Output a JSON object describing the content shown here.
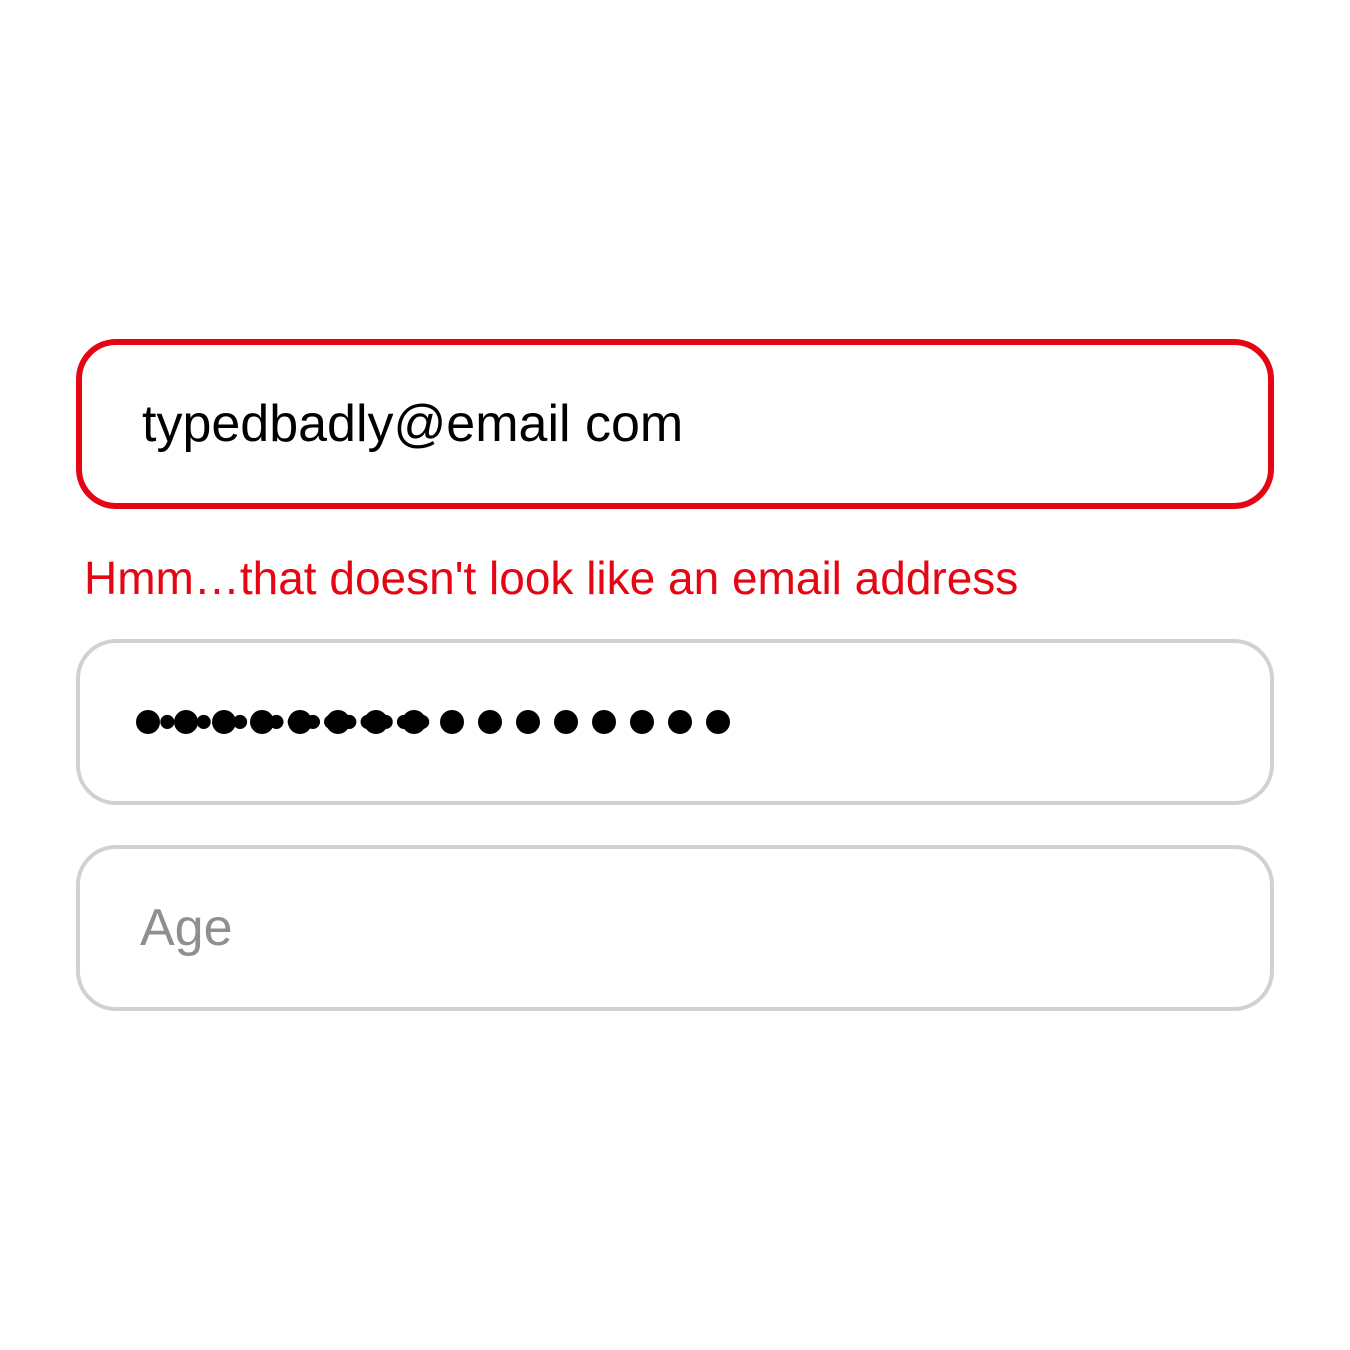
{
  "form": {
    "email": {
      "value": "typedbadly@email com",
      "error_message": "Hmm…that doesn't look like an email address"
    },
    "password": {
      "value": "••••••••••••••••",
      "dot_count": 16
    },
    "age": {
      "placeholder": "Age",
      "value": ""
    }
  },
  "colors": {
    "error": "#e40613",
    "border": "#d1d1d1",
    "placeholder": "#8e8e93"
  }
}
